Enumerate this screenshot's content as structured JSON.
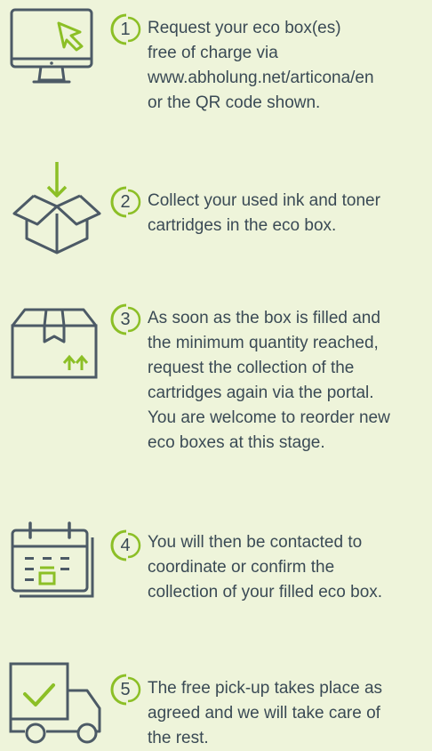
{
  "colors": {
    "background": "#eef4da",
    "icon_stroke": "#4c5a66",
    "accent": "#8cbf26",
    "text": "#3a4a55"
  },
  "steps": [
    {
      "number": "1",
      "icon": "computer-monitor-cursor-icon",
      "lines": [
        "Request your eco box(es)",
        "free of charge via",
        "www.abholung.net/articona/en",
        "or the QR code shown."
      ]
    },
    {
      "number": "2",
      "icon": "open-box-arrow-down-icon",
      "lines": [
        "Collect your used ink and toner",
        "cartridges in the eco box."
      ]
    },
    {
      "number": "3",
      "icon": "closed-box-arrows-up-icon",
      "lines": [
        "As soon as the box is filled and",
        "the minimum quantity reached,",
        "request the collection of the",
        "cartridges again via the portal.",
        "You are welcome to reorder new",
        "eco boxes at this stage."
      ]
    },
    {
      "number": "4",
      "icon": "calendar-icon",
      "lines": [
        "You will then be contacted to",
        "coordinate or confirm the",
        "collection of your filled eco box."
      ]
    },
    {
      "number": "5",
      "icon": "delivery-truck-check-icon",
      "lines": [
        "The free pick-up takes place as",
        "agreed and we will take care of",
        "the rest."
      ]
    }
  ]
}
